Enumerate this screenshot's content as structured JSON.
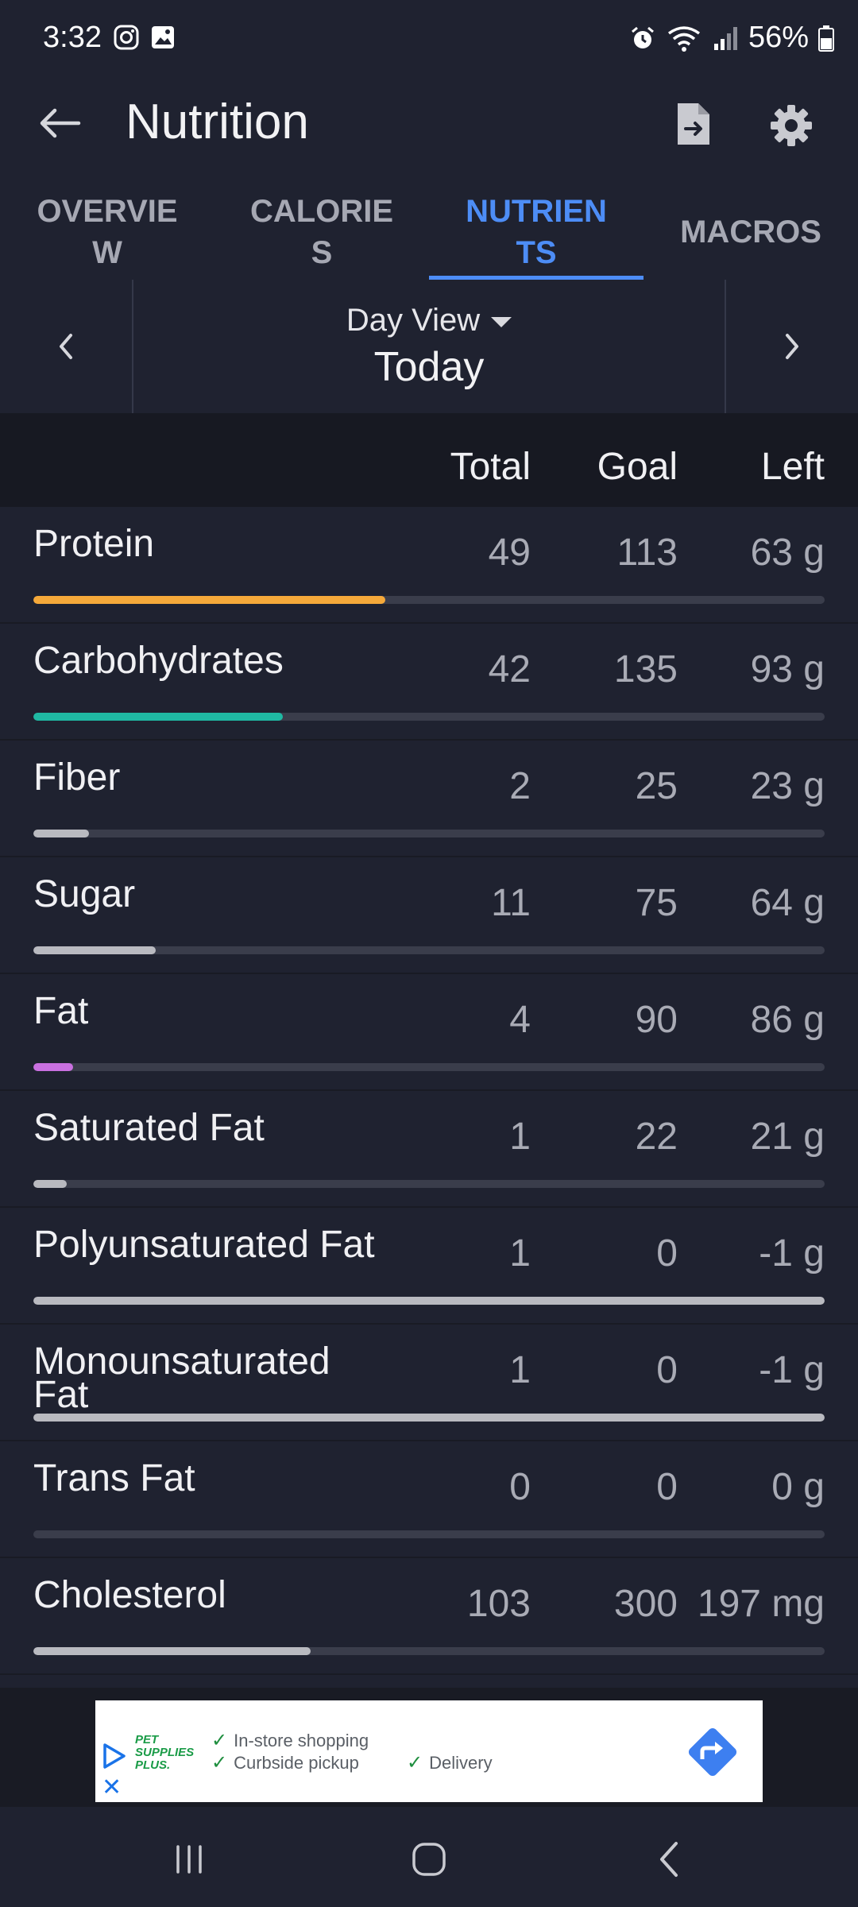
{
  "status_bar": {
    "time": "3:32",
    "battery": "56%",
    "left_icons": [
      "instagram-icon",
      "gallery-icon"
    ],
    "right_icons": [
      "alarm-icon",
      "wifi-icon",
      "signal-icon",
      "battery-icon"
    ]
  },
  "app_bar": {
    "title": "Nutrition",
    "icons": [
      "back-arrow-icon",
      "export-file-icon",
      "settings-gear-icon"
    ]
  },
  "tabs": [
    {
      "label": "OVERVIEW",
      "active": false
    },
    {
      "label": "CALORIES",
      "active": false
    },
    {
      "label": "NUTRIENTS",
      "active": true
    },
    {
      "label": "MACROS",
      "active": false
    }
  ],
  "date_nav": {
    "view_label": "Day View",
    "date_label": "Today"
  },
  "columns": {
    "total": "Total",
    "goal": "Goal",
    "left": "Left"
  },
  "nutrients": [
    {
      "name": "Protein",
      "total": "49",
      "goal": "113",
      "left": "63 g",
      "progress": 0.445,
      "color": "#f5a93a"
    },
    {
      "name": "Carbohydrates",
      "total": "42",
      "goal": "135",
      "left": "93 g",
      "progress": 0.315,
      "color": "#1fb9a3"
    },
    {
      "name": "Fiber",
      "total": "2",
      "goal": "25",
      "left": "23 g",
      "progress": 0.07,
      "color": "#b9bac0"
    },
    {
      "name": "Sugar",
      "total": "11",
      "goal": "75",
      "left": "64 g",
      "progress": 0.155,
      "color": "#b9bac0"
    },
    {
      "name": "Fat",
      "total": "4",
      "goal": "90",
      "left": "86 g",
      "progress": 0.05,
      "color": "#c970e0"
    },
    {
      "name": "Saturated Fat",
      "total": "1",
      "goal": "22",
      "left": "21 g",
      "progress": 0.042,
      "color": "#b9bac0"
    },
    {
      "name": "Polyunsaturated Fat",
      "total": "1",
      "goal": "0",
      "left": "-1 g",
      "progress": 1.0,
      "color": "#b9bac0"
    },
    {
      "name": "Monounsaturated Fat",
      "total": "1",
      "goal": "0",
      "left": "-1 g",
      "progress": 1.0,
      "color": "#b9bac0"
    },
    {
      "name": "Trans Fat",
      "total": "0",
      "goal": "0",
      "left": "0 g",
      "progress": 0.0,
      "color": "#b9bac0"
    },
    {
      "name": "Cholesterol",
      "total": "103",
      "goal": "300",
      "left": "197 mg",
      "progress": 0.35,
      "color": "#b9bac0"
    }
  ],
  "ad": {
    "brand_line1": "PET",
    "brand_line2": "SUPPLIES",
    "brand_line3": "PLUS.",
    "feature_1": "In-store shopping",
    "feature_2": "Curbside pickup",
    "feature_3": "Delivery",
    "cta_icon": "directions-icon",
    "accent_color": "#3d7ff0"
  },
  "system_nav": {
    "icons": [
      "recents-icon",
      "home-icon",
      "back-icon"
    ]
  }
}
